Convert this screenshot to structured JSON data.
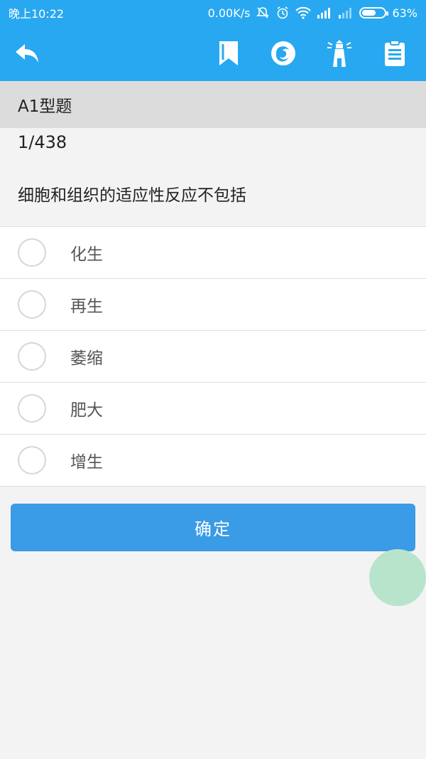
{
  "statusbar": {
    "time": "晚上10:22",
    "speed": "0.00K/s",
    "battery": "63%",
    "battery_level": 0.63
  },
  "toolbar": {
    "icons": {
      "back": "back-arrow-icon",
      "bookmark": "bookmark-icon",
      "firefox": "firefox-icon",
      "lighthouse": "lighthouse-icon",
      "clipboard": "clipboard-icon"
    },
    "color": "#28a8f0"
  },
  "category": {
    "label": "A1型题"
  },
  "question": {
    "counter": "1/438",
    "text": "细胞和组织的适应性反应不包括"
  },
  "options": [
    {
      "label": "化生"
    },
    {
      "label": "再生"
    },
    {
      "label": "萎缩"
    },
    {
      "label": "肥大"
    },
    {
      "label": "增生"
    }
  ],
  "confirm": {
    "label": "确定",
    "color": "#3a9be6"
  }
}
